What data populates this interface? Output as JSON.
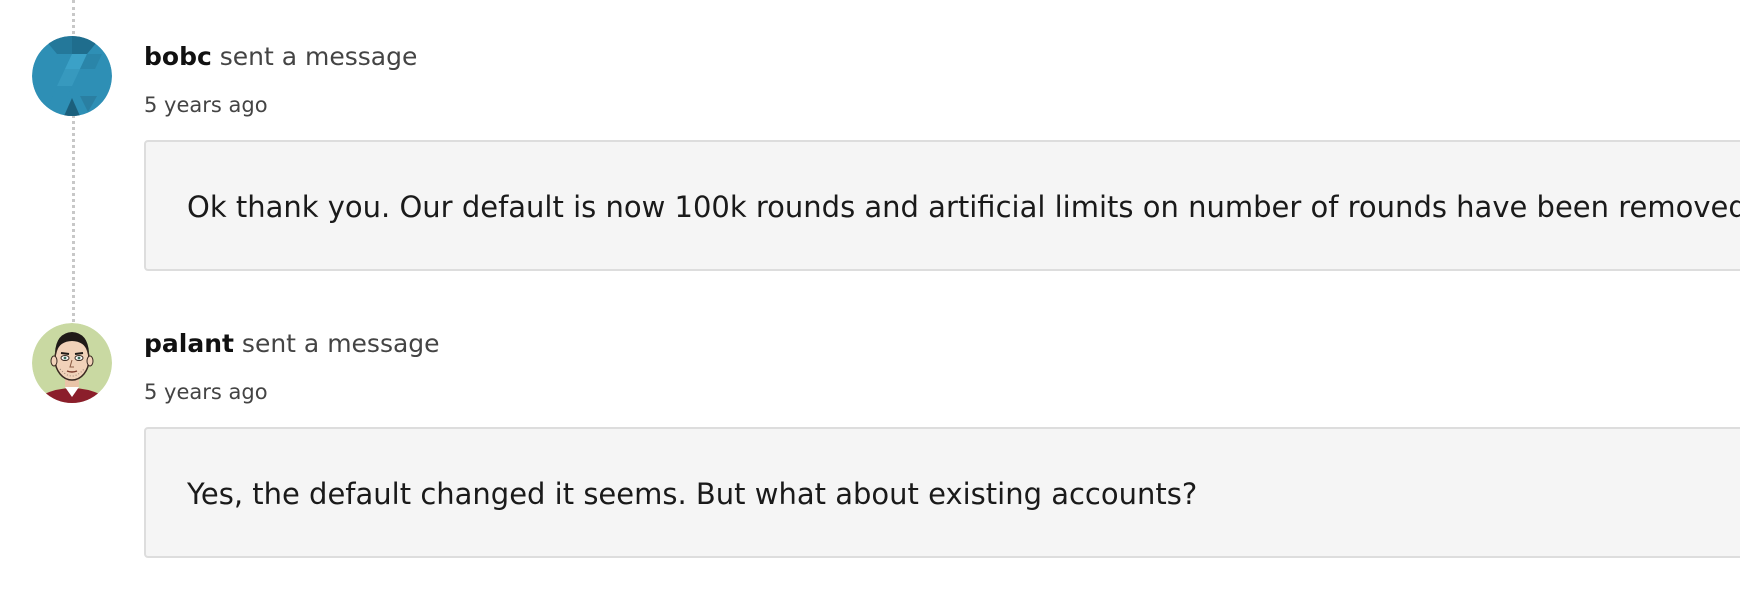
{
  "messages": [
    {
      "author": "bobc",
      "action": "sent a message",
      "time": "5 years ago",
      "body": "Ok thank you. Our default is now 100k rounds and artificial limits on number of rounds have been removed.",
      "avatar_icon": "geometric-avatar-icon",
      "avatar_color": "#2e8fb5"
    },
    {
      "author": "palant",
      "action": "sent a message",
      "time": "5 years ago",
      "body": "Yes, the default changed it seems. But what about existing accounts?",
      "avatar_icon": "cartoon-face-avatar-icon",
      "avatar_color": "#c9d9a2"
    }
  ],
  "colors": {
    "message_background": "#f5f5f5",
    "message_border": "#dddddd",
    "timeline": "#c8c8c8"
  }
}
